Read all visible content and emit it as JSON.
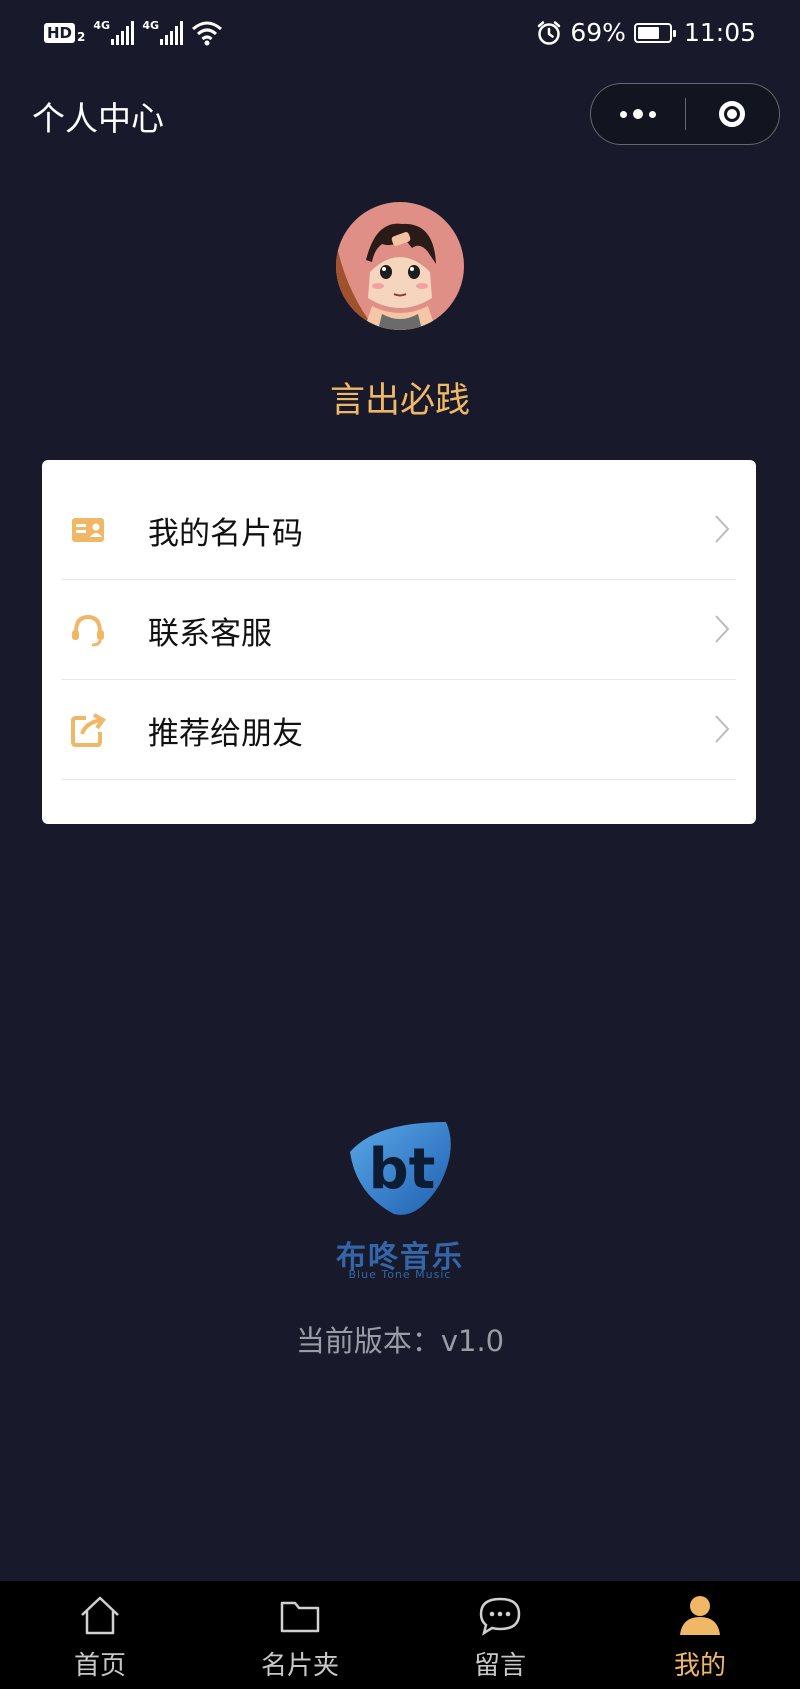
{
  "status_bar": {
    "hd_label": "HD",
    "hd_sub": "2",
    "network_1": "4G",
    "network_2": "4G",
    "battery_percent_text": "69%",
    "battery_level": 0.69,
    "time": "11:05",
    "icons": [
      "alarm-icon",
      "wifi-icon",
      "battery-icon",
      "signal-icon"
    ]
  },
  "navbar": {
    "title": "个人中心",
    "capsule": {
      "more_icon": "more-dots-icon",
      "close_icon": "target-close-icon"
    }
  },
  "profile": {
    "username": "言出必践",
    "avatar": "avatar-anime-boy"
  },
  "menu": {
    "items": [
      {
        "label": "我的名片码",
        "icon": "id-card-icon"
      },
      {
        "label": "联系客服",
        "icon": "headset-icon"
      },
      {
        "label": "推荐给朋友",
        "icon": "share-icon"
      }
    ]
  },
  "brand": {
    "logo_text": "bt",
    "name_cn": "布咚音乐",
    "name_en": "Blue Tone Music"
  },
  "version_text": "当前版本：v1.0",
  "tabbar": {
    "tabs": [
      {
        "label": "首页",
        "icon": "home-icon",
        "active": false
      },
      {
        "label": "名片夹",
        "icon": "folder-icon",
        "active": false
      },
      {
        "label": "留言",
        "icon": "chat-icon",
        "active": false
      },
      {
        "label": "我的",
        "icon": "user-icon",
        "active": true
      }
    ]
  },
  "colors": {
    "background": "#181a2b",
    "accent": "#f0b766",
    "card": "#ffffff",
    "tabbar": "#000000",
    "brand_blue": "#3366a8"
  }
}
